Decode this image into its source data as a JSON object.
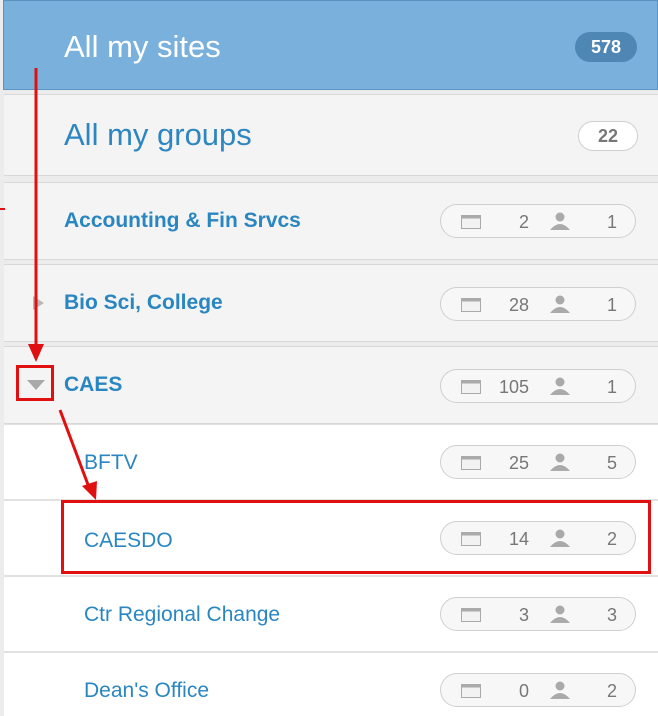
{
  "header": {
    "title": "All my sites",
    "count": "578"
  },
  "groups_row": {
    "title": "All my groups",
    "count": "22"
  },
  "groups": [
    {
      "name": "Accounting & Fin Srvcs",
      "sites": "2",
      "users": "1"
    },
    {
      "name": "Bio Sci, College",
      "sites": "28",
      "users": "1"
    },
    {
      "name": "CAES",
      "sites": "105",
      "users": "1"
    }
  ],
  "subgroups": [
    {
      "name": "BFTV",
      "sites": "25",
      "users": "5"
    },
    {
      "name": "CAESDO",
      "sites": "14",
      "users": "2"
    },
    {
      "name": "Ctr Regional Change",
      "sites": "3",
      "users": "3"
    },
    {
      "name": "Dean's Office",
      "sites": "0",
      "users": "2"
    }
  ],
  "icons": {
    "sites": "calendar-icon",
    "users": "user-icon",
    "collapsed": "triangle-right-icon",
    "expanded": "triangle-down-icon"
  },
  "colors": {
    "header_bg": "#79b0dc",
    "link": "#2a86c1",
    "annotation": "#e01010"
  }
}
